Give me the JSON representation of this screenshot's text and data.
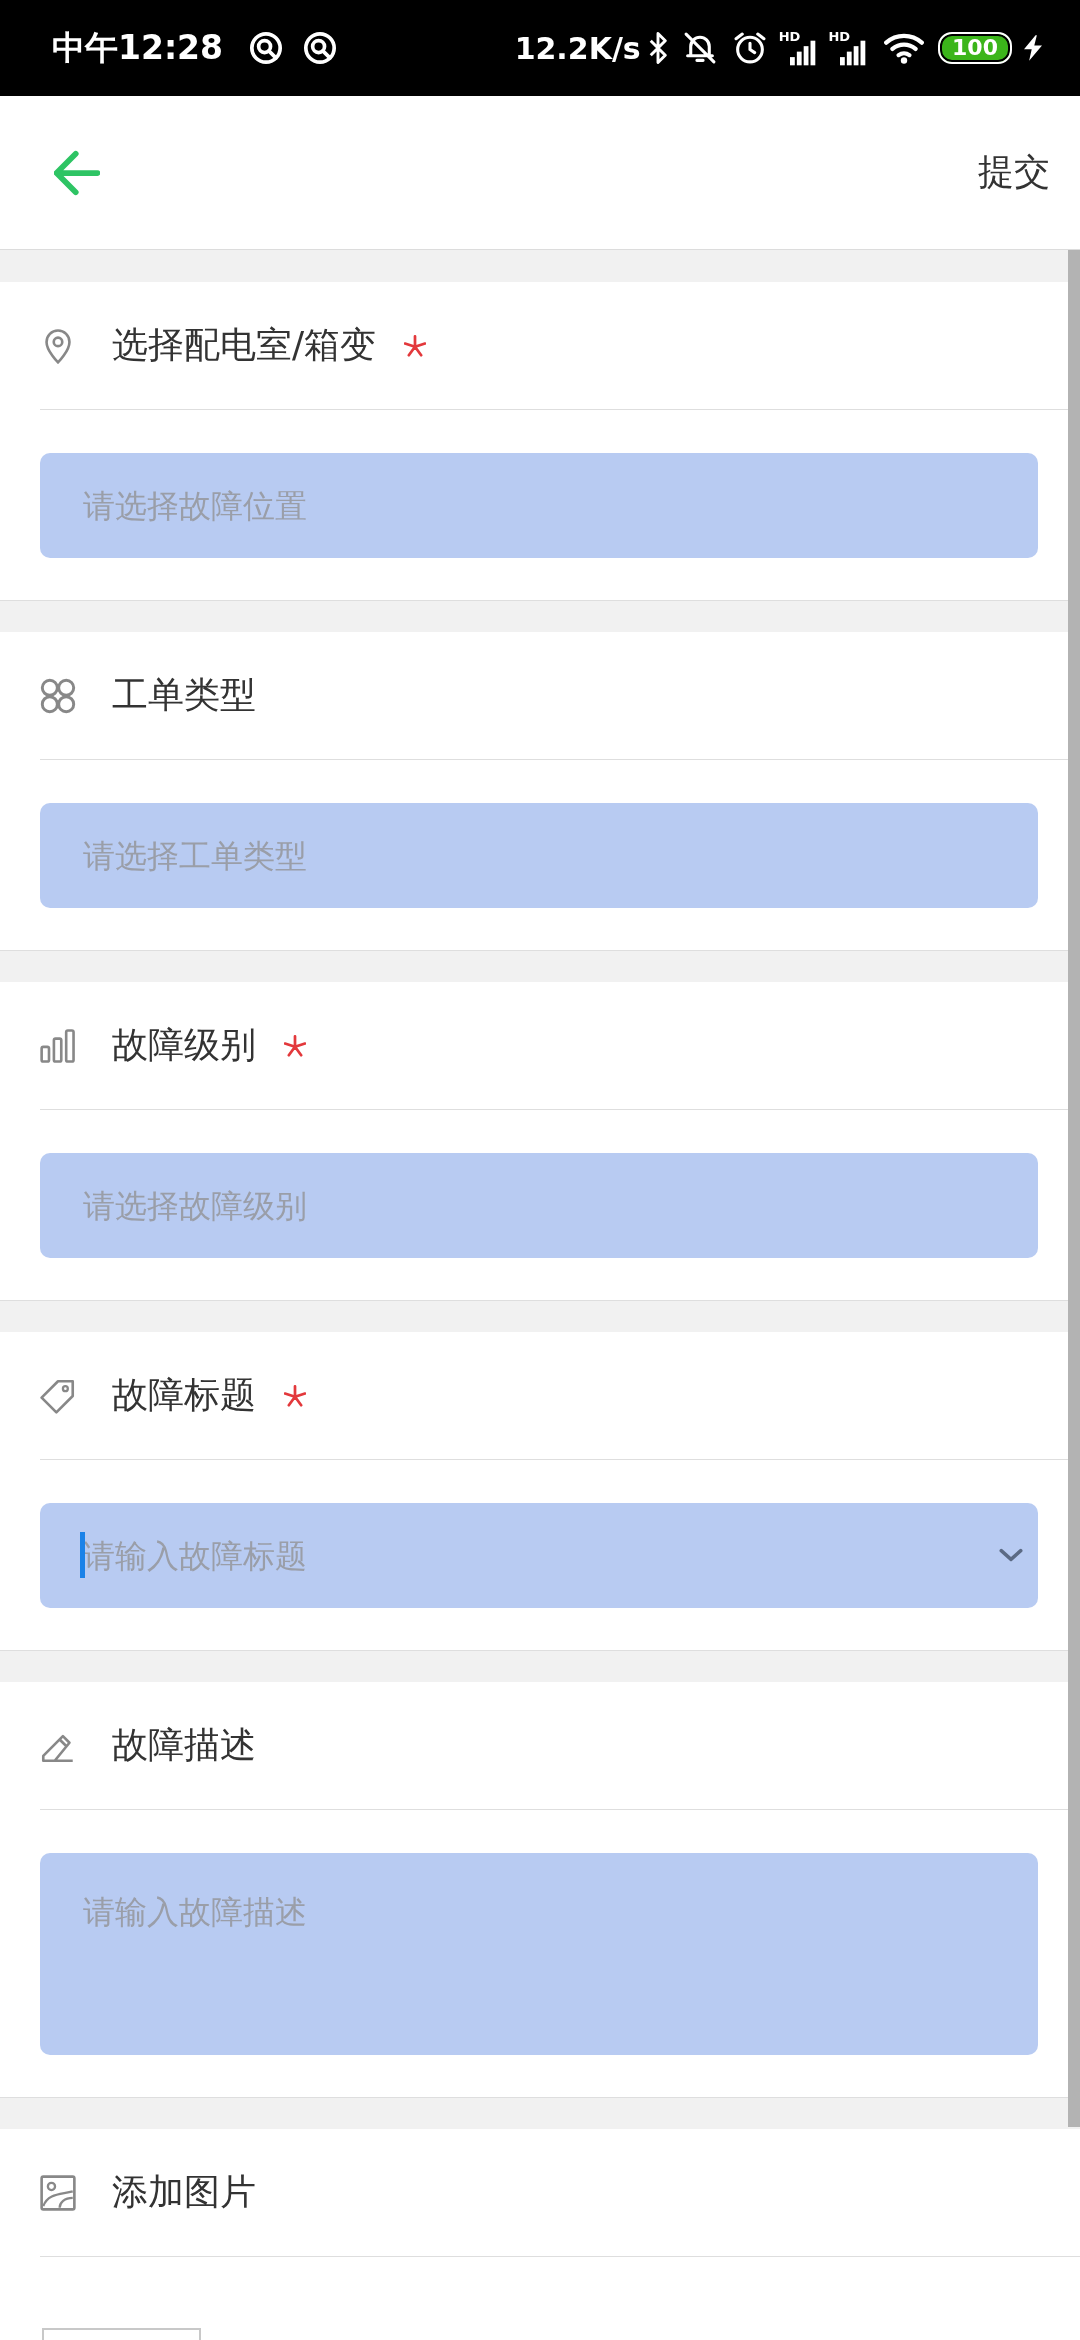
{
  "status_bar": {
    "time": "中午12:28",
    "network_speed": "12.2K/s",
    "network_labels": [
      "HD",
      "HD"
    ],
    "battery": "100"
  },
  "app_bar": {
    "action": "提交"
  },
  "sections": [
    {
      "kind": "location",
      "label": "选择配电室/箱变",
      "required": true,
      "field": {
        "kind": "picker",
        "placeholder": "请选择故障位置",
        "focused": false
      }
    },
    {
      "kind": "category",
      "label": "工单类型",
      "required": false,
      "field": {
        "kind": "picker",
        "placeholder": "请选择工单类型",
        "focused": false
      }
    },
    {
      "kind": "level",
      "label": "故障级别",
      "required": true,
      "field": {
        "kind": "picker",
        "placeholder": "请选择故障级别",
        "focused": false
      }
    },
    {
      "kind": "title",
      "label": "故障标题",
      "required": true,
      "field": {
        "kind": "combo",
        "placeholder": "请输入故障标题",
        "focused": true
      }
    },
    {
      "kind": "description",
      "label": "故障描述",
      "required": false,
      "field": {
        "kind": "textarea",
        "placeholder": "请输入故障描述",
        "focused": false
      }
    },
    {
      "kind": "photos",
      "label": "添加图片",
      "required": false
    }
  ]
}
